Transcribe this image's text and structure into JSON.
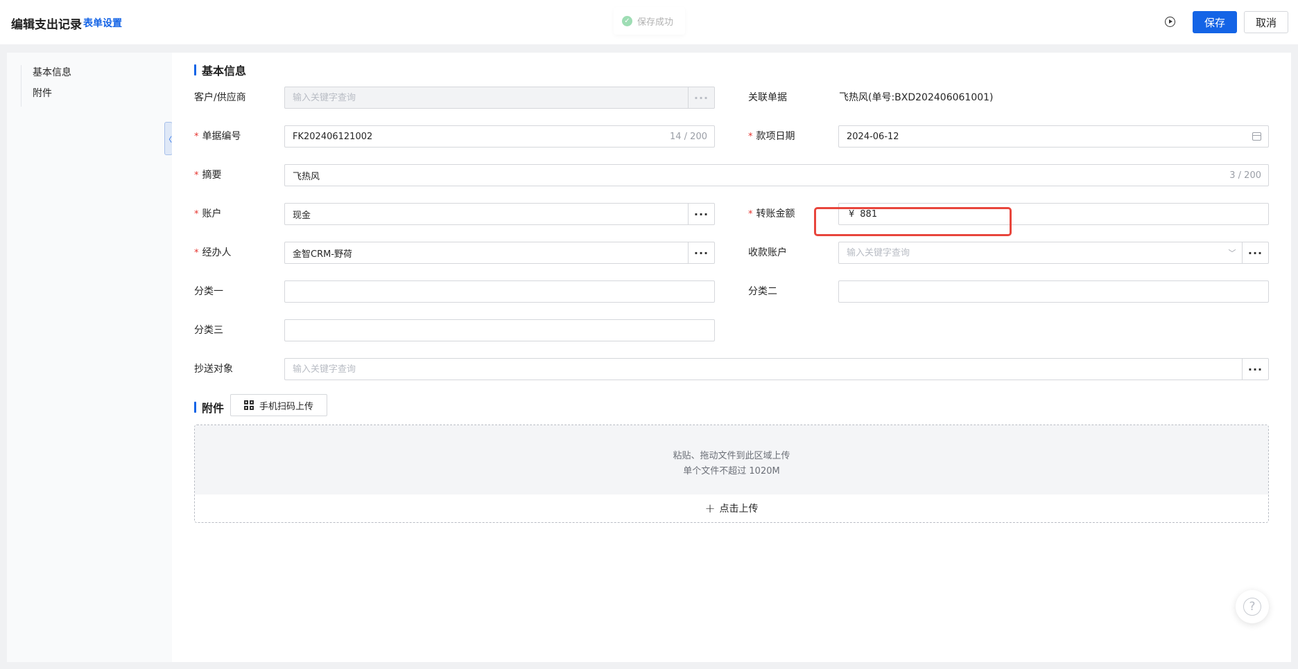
{
  "header": {
    "title": "编辑支出记录",
    "form_settings": "表单设置",
    "toast": "保存成功",
    "save": "保存",
    "cancel": "取消"
  },
  "sidebar": {
    "items": [
      {
        "label": "基本信息"
      },
      {
        "label": "附件"
      }
    ]
  },
  "basic_section": {
    "title": "基本信息"
  },
  "form": {
    "customer": {
      "label": "客户/供应商",
      "value": "",
      "placeholder": "输入关键字查询"
    },
    "related_doc": {
      "label": "关联单据",
      "value": "飞热风(单号:BXD202406061001)"
    },
    "doc_no": {
      "label": "单据编号",
      "required": true,
      "value": "FK202406121002",
      "count": "14 / 200"
    },
    "date": {
      "label": "款项日期",
      "required": true,
      "value": "2024-06-12"
    },
    "summary": {
      "label": "摘要",
      "required": true,
      "value": "飞热风",
      "count": "3 / 200"
    },
    "account": {
      "label": "账户",
      "required": true,
      "value": "现金"
    },
    "amount": {
      "label": "转账金额",
      "required": true,
      "currency": "¥",
      "value": "881"
    },
    "handler": {
      "label": "经办人",
      "required": true,
      "value": "金智CRM-野荷"
    },
    "receive_account": {
      "label": "收款账户",
      "value": "",
      "placeholder": "输入关键字查询"
    },
    "category1": {
      "label": "分类一",
      "value": ""
    },
    "category2": {
      "label": "分类二",
      "value": ""
    },
    "category3": {
      "label": "分类三",
      "value": ""
    },
    "cc": {
      "label": "抄送对象",
      "value": "",
      "placeholder": "输入关键字查询"
    }
  },
  "attachment_section": {
    "title": "附件",
    "scan_button": "手机扫码上传",
    "drop_line1": "粘贴、拖动文件到此区域上传",
    "drop_line2": "单个文件不超过 1020M",
    "upload_button": "点击上传"
  },
  "help": {
    "symbol": "?"
  },
  "colors": {
    "primary": "#1464e6",
    "required": "#e5322d",
    "highlight": "#e8453c",
    "success": "#2bb55a"
  }
}
